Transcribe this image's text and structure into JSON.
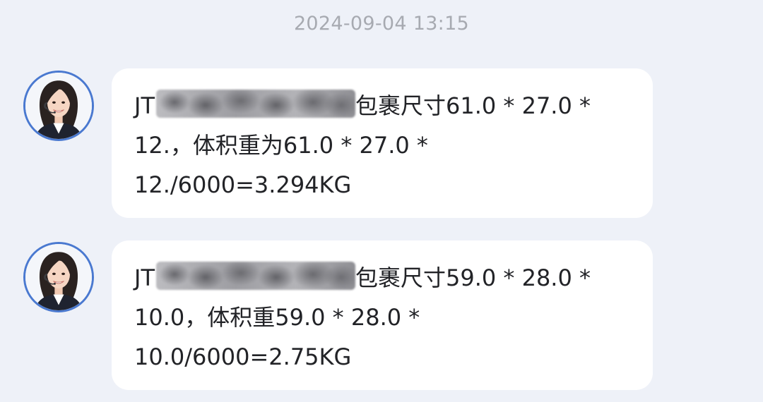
{
  "timestamp": "2024-09-04 13:15",
  "messages": [
    {
      "sender": "agent",
      "tracking_prefix": "JT",
      "line1_tail": "包裹尺寸61.0 * 27.0 *",
      "line2": "12.，体积重为61.0 * 27.0 *",
      "line3": "12./6000=3.294KG"
    },
    {
      "sender": "agent",
      "tracking_prefix": "JT",
      "line1_tail": "包裹尺寸59.0 * 28.0 *",
      "line2": "10.0，体积重59.0 * 28.0 *",
      "line3": "10.0/6000=2.75KG"
    }
  ],
  "colors": {
    "background": "#eef1f8",
    "bubble": "#ffffff",
    "avatar_border": "#4a79d0",
    "timestamp_text": "#a7aab1",
    "message_text": "#222327"
  }
}
